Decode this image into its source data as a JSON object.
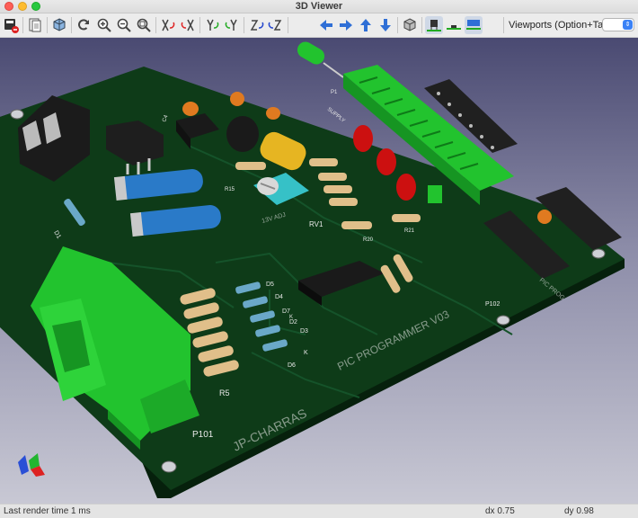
{
  "window": {
    "title": "3D Viewer"
  },
  "toolbar": {
    "buttons": [
      {
        "name": "render-button",
        "icon": "render-icon"
      },
      {
        "name": "copy-button",
        "icon": "copy-icon"
      },
      {
        "name": "raytrace-toggle",
        "icon": "cube-icon"
      },
      {
        "name": "reload-button",
        "icon": "refresh-icon"
      },
      {
        "name": "zoom-in-button",
        "icon": "zoom-in-icon"
      },
      {
        "name": "zoom-out-button",
        "icon": "zoom-out-icon"
      },
      {
        "name": "zoom-fit-button",
        "icon": "zoom-fit-icon"
      },
      {
        "name": "rotate-x-cw-button",
        "icon": "rotate-x-cw-icon"
      },
      {
        "name": "rotate-x-ccw-button",
        "icon": "rotate-x-ccw-icon"
      },
      {
        "name": "rotate-y-cw-button",
        "icon": "rotate-y-cw-icon"
      },
      {
        "name": "rotate-y-ccw-button",
        "icon": "rotate-y-ccw-icon"
      },
      {
        "name": "rotate-z-cw-button",
        "icon": "rotate-z-cw-icon"
      },
      {
        "name": "rotate-z-ccw-button",
        "icon": "rotate-z-ccw-icon"
      },
      {
        "name": "pan-left-button",
        "icon": "arrow-left-icon"
      },
      {
        "name": "pan-right-button",
        "icon": "arrow-right-icon"
      },
      {
        "name": "pan-up-button",
        "icon": "arrow-up-icon"
      },
      {
        "name": "pan-down-button",
        "icon": "arrow-down-icon"
      },
      {
        "name": "ortho-toggle",
        "icon": "ortho-cube-icon"
      },
      {
        "name": "show-th-button",
        "icon": "tht-icon"
      },
      {
        "name": "show-smd-button",
        "icon": "smd-icon"
      },
      {
        "name": "show-virtual-button",
        "icon": "virtual-icon"
      }
    ],
    "viewports_label": "Viewports (Option+Tab):",
    "viewports_selected": ""
  },
  "scene": {
    "silkscreen": {
      "title": "PIC PROGRAMMER V03",
      "author": "JP-CHARRAS",
      "p101": "P101",
      "p102": "P102",
      "r5": "R5",
      "rv1": "RV1",
      "r15": "R15",
      "r20": "R20",
      "r21": "R21",
      "d1": "D1",
      "d2": "D2",
      "d3": "D3",
      "d4": "D4",
      "d5": "D5",
      "d6": "D6",
      "d7": "D7",
      "c4": "C4",
      "supply": "SUPPLY",
      "adj": "13V ADJ",
      "k1": "K",
      "k2": "K",
      "pic_prog": "PIC PROG",
      "p1": "P1"
    },
    "colors": {
      "board": "#0e3b18",
      "board_edge": "#06200c",
      "connector": "#22c32e",
      "led": "#cc1010",
      "capacitor_blue": "#2a7ac8",
      "resistor_body": "#e0bf8a",
      "ic": "#1a1a1a",
      "copper_trace": "#15532a"
    }
  },
  "status": {
    "left": "Last render time 1 ms",
    "dx": "dx 0.75",
    "dy": "dy 0.98"
  }
}
